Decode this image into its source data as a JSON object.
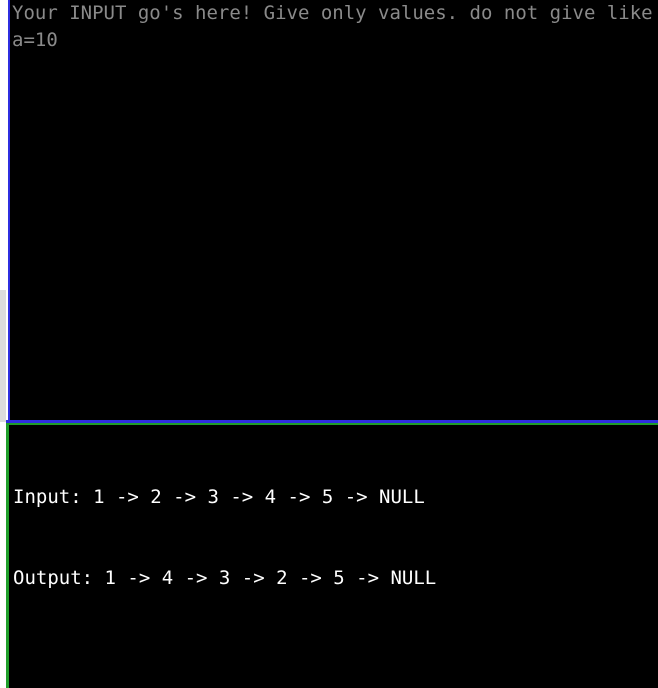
{
  "input_pane": {
    "placeholder": "Your INPUT go's here! Give only values. do not give like a=10",
    "value": ""
  },
  "output_pane": {
    "lines": [
      "Input: 1 -> 2 -> 3 -> 4 -> 5 -> NULL",
      "Output: 1 -> 4 -> 3 -> 2 -> 5 -> NULL"
    ]
  },
  "colors": {
    "pane_background": "#000000",
    "input_border": "#2f2fe0",
    "output_border": "#1f9e2a",
    "placeholder_text": "#8a8a8a",
    "output_text": "#ffffff"
  }
}
